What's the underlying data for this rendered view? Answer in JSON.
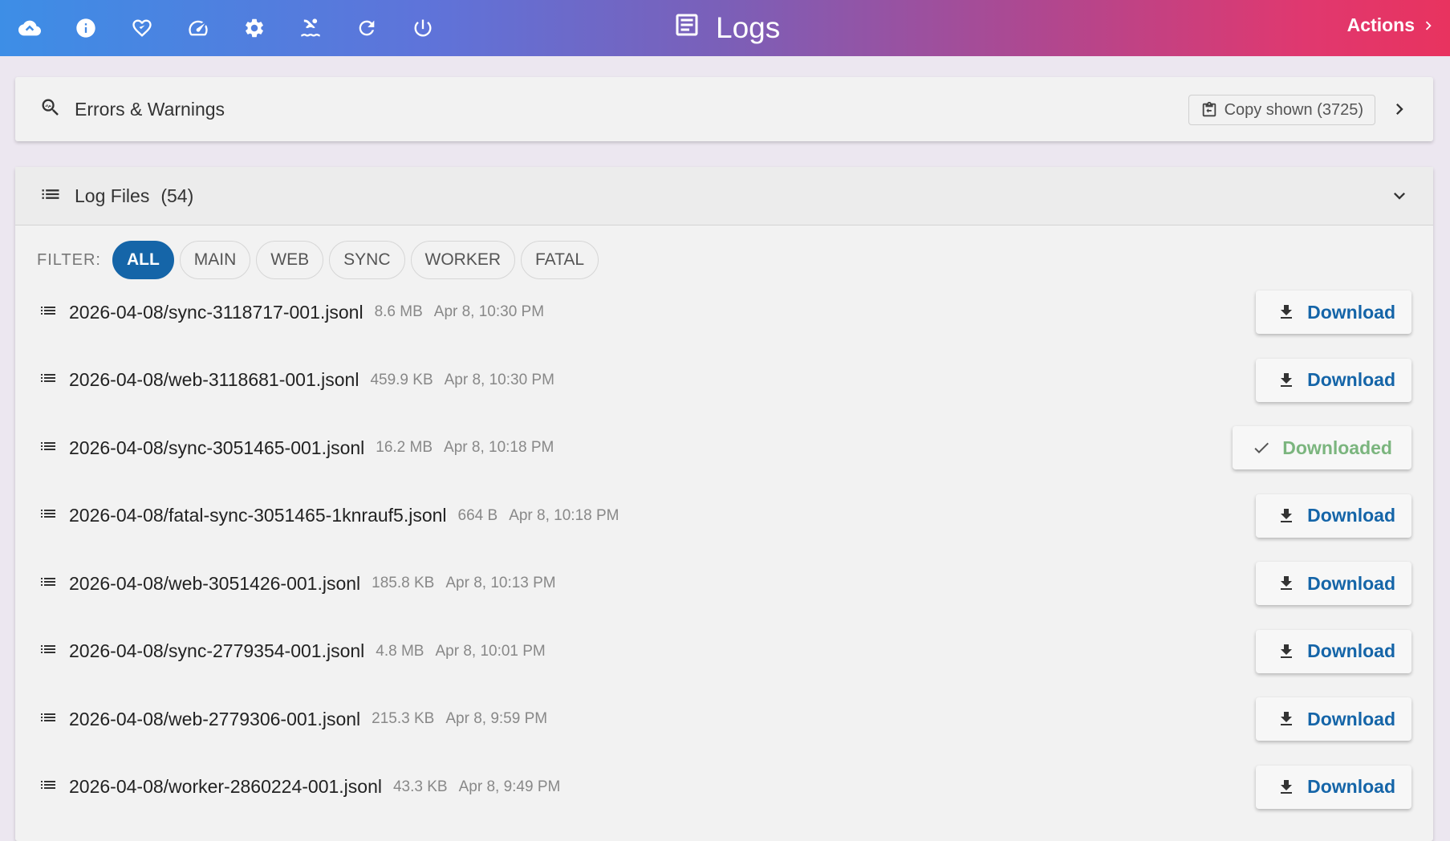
{
  "header": {
    "title": "Logs",
    "actions_label": "Actions",
    "nav_icons": [
      "cloud-icon",
      "info-icon",
      "health-icon",
      "speed-icon",
      "settings-icon",
      "swim-icon",
      "refresh-icon",
      "power-icon"
    ]
  },
  "errors_panel": {
    "title": "Errors & Warnings",
    "copy_label": "Copy shown (3725)"
  },
  "logs_panel": {
    "title": "Log Files",
    "count": "(54)",
    "filter_label": "FILTER:",
    "filters": [
      "ALL",
      "MAIN",
      "WEB",
      "SYNC",
      "WORKER",
      "FATAL"
    ],
    "active_filter": "ALL",
    "files": [
      {
        "name": "2026-04-08/sync-3118717-001.jsonl",
        "size": "8.6 MB",
        "date": "Apr 8, 10:30 PM",
        "button": "Download",
        "downloaded": false
      },
      {
        "name": "2026-04-08/web-3118681-001.jsonl",
        "size": "459.9 KB",
        "date": "Apr 8, 10:30 PM",
        "button": "Download",
        "downloaded": false
      },
      {
        "name": "2026-04-08/sync-3051465-001.jsonl",
        "size": "16.2 MB",
        "date": "Apr 8, 10:18 PM",
        "button": "Downloaded",
        "downloaded": true
      },
      {
        "name": "2026-04-08/fatal-sync-3051465-1knrauf5.jsonl",
        "size": "664 B",
        "date": "Apr 8, 10:18 PM",
        "button": "Download",
        "downloaded": false
      },
      {
        "name": "2026-04-08/web-3051426-001.jsonl",
        "size": "185.8 KB",
        "date": "Apr 8, 10:13 PM",
        "button": "Download",
        "downloaded": false
      },
      {
        "name": "2026-04-08/sync-2779354-001.jsonl",
        "size": "4.8 MB",
        "date": "Apr 8, 10:01 PM",
        "button": "Download",
        "downloaded": false
      },
      {
        "name": "2026-04-08/web-2779306-001.jsonl",
        "size": "215.3 KB",
        "date": "Apr 8, 9:59 PM",
        "button": "Download",
        "downloaded": false
      },
      {
        "name": "2026-04-08/worker-2860224-001.jsonl",
        "size": "43.3 KB",
        "date": "Apr 8, 9:49 PM",
        "button": "Download",
        "downloaded": false
      }
    ]
  },
  "colors": {
    "accent": "#1565a8",
    "downloaded": "#7bb57e",
    "gradient_start": "#3d8ee6",
    "gradient_end": "#e8335f"
  }
}
